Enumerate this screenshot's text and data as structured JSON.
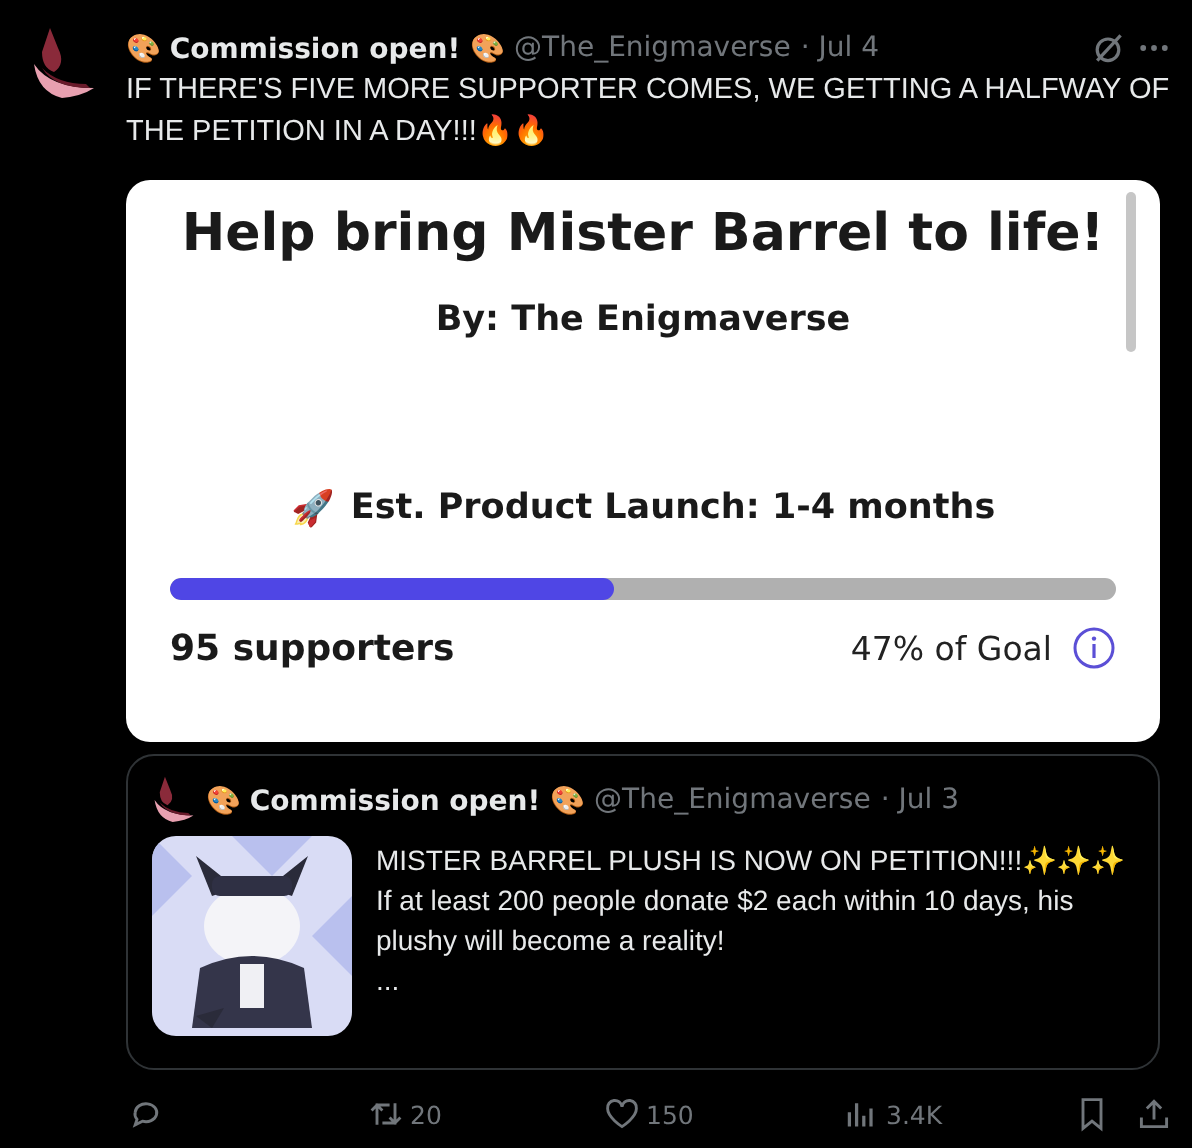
{
  "post": {
    "display_name_prefix": "🎨",
    "display_name": "Commission open!",
    "display_name_suffix": "🎨",
    "handle": "@The_Enigmaverse",
    "date": "· Jul 4",
    "text": "IF THERE'S FIVE MORE SUPPORTER COMES, WE GETTING A HALFWAY OF THE PETITION IN A DAY!!!🔥🔥"
  },
  "petition_card": {
    "title": "Help bring Mister Barrel to life!",
    "byline": "By: The Enigmaverse",
    "launch_icon": "🚀",
    "launch": "Est. Product Launch: 1-4 months",
    "level": 0.47,
    "supporters": "95 supporters",
    "goal": "47% of Goal"
  },
  "quoted_post": {
    "display_name_prefix": "🎨",
    "display_name": "Commission open!",
    "display_name_suffix": "🎨",
    "handle": "@The_Enigmaverse",
    "date": "· Jul 3",
    "lines": [
      "MISTER BARREL PLUSH IS NOW ON PETITION!!!✨✨✨",
      "If at least 200 people donate $2 each within 10 days, his plushy will become a reality!",
      "..."
    ]
  },
  "actions": [
    {
      "kind": "reply"
    },
    {
      "kind": "repost",
      "count": "20"
    },
    {
      "kind": "like",
      "count": "150"
    },
    {
      "kind": "views",
      "count": "3.4K"
    },
    {
      "kind": "bookmark"
    },
    {
      "kind": "share"
    }
  ]
}
